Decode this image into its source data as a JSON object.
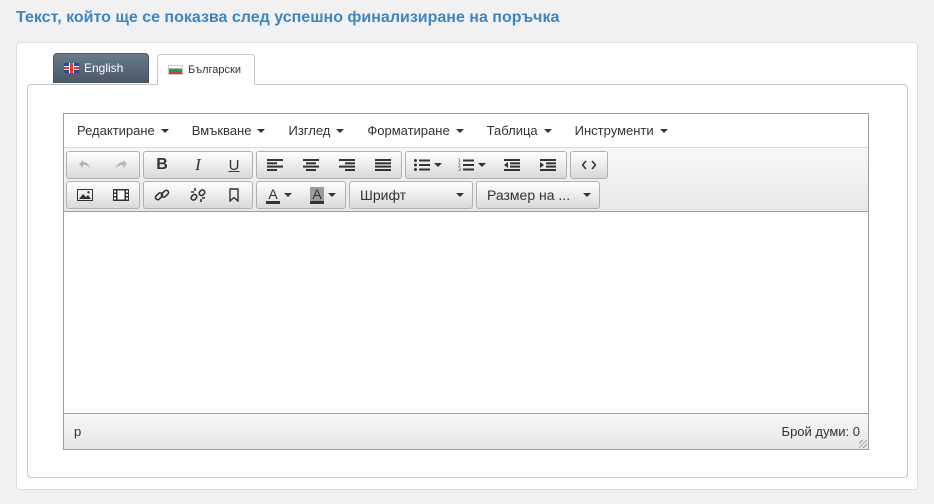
{
  "page": {
    "title": "Текст, който ще се показва след успешно финализиране на поръчка"
  },
  "tabs": [
    {
      "label": "English",
      "flag": "uk-flag",
      "active": false
    },
    {
      "label": "Български",
      "flag": "bg-flag",
      "active": true
    }
  ],
  "menubar": {
    "items": [
      "Редактиране",
      "Вмъкване",
      "Изглед",
      "Форматиране",
      "Таблица",
      "Инструменти"
    ]
  },
  "toolbar": {
    "row1": [
      "undo-icon",
      "redo-icon",
      "bold-icon",
      "italic-icon",
      "underline-icon",
      "align-left-icon",
      "align-center-icon",
      "align-right-icon",
      "align-justify-icon",
      "bullet-list-icon",
      "numbered-list-icon",
      "outdent-icon",
      "indent-icon",
      "source-code-icon"
    ],
    "row2": [
      "image-icon",
      "media-icon",
      "link-icon",
      "unlink-icon",
      "bookmark-icon",
      "text-color-icon",
      "background-color-icon"
    ],
    "font_select": "Шрифт",
    "size_select": "Размер на ..."
  },
  "statusbar": {
    "path": "p",
    "wordcount": "Брой думи: 0"
  },
  "colors": {
    "title": "#3d86c2",
    "tab_active_bg": "#4b5967"
  }
}
